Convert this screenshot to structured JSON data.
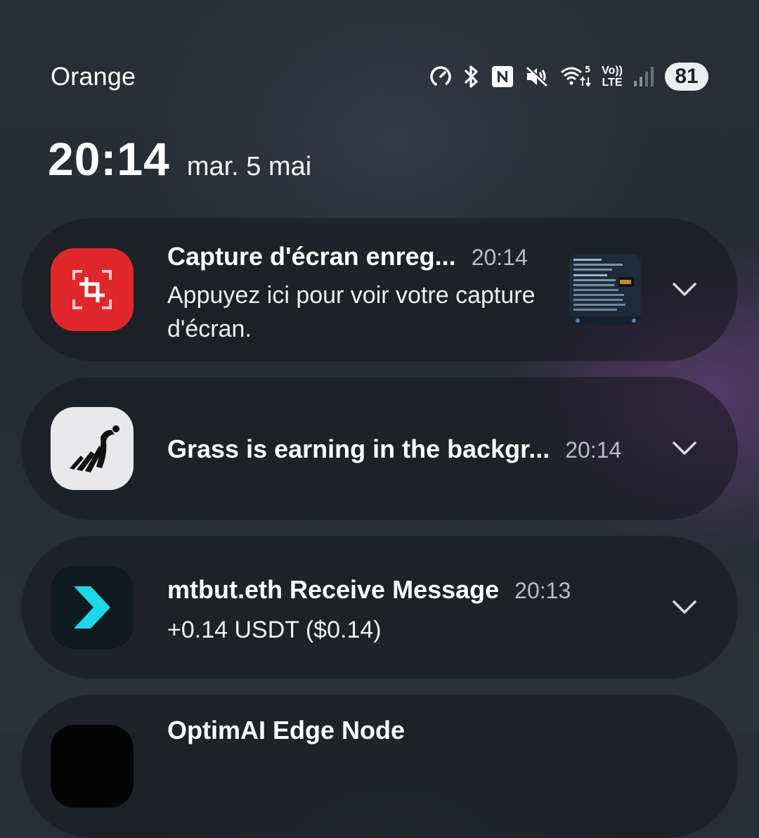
{
  "status_bar": {
    "carrier": "Orange",
    "icons": [
      "data-saver-icon",
      "bluetooth-icon",
      "nfc-icon",
      "mute-icon",
      "wifi-icon",
      "volte-icon",
      "signal-icon"
    ],
    "wifi_label": "5",
    "volte_top": "Vo))",
    "volte_bottom": "LTE",
    "battery_level": "81"
  },
  "header": {
    "time": "20:14",
    "date": "mar. 5 mai"
  },
  "notifications": [
    {
      "app_icon": "screenshot-icon",
      "title": "Capture d'écran enreg...",
      "time": "20:14",
      "body": "Appuyez ici pour voir votre capture d'écran.",
      "has_thumbnail": true,
      "accent": "#e0282c"
    },
    {
      "app_icon": "grass-logo-icon",
      "title": "Grass is earning in the backgr...",
      "time": "20:14",
      "body": "",
      "accent": "#e9e9eb"
    },
    {
      "app_icon": "chevron-logo-icon",
      "title": "mtbut.eth Receive Message",
      "time": "20:13",
      "body": "+0.14 USDT ($0.14)",
      "accent": "#1ed7e6"
    },
    {
      "app_icon": "optimai-logo-icon",
      "title": "OptimAI Edge Node",
      "time": "",
      "body": ""
    }
  ],
  "colors": {
    "background": "#2a2f37",
    "card": "#1b1d23",
    "secondary_text": "#b8bcc4"
  }
}
